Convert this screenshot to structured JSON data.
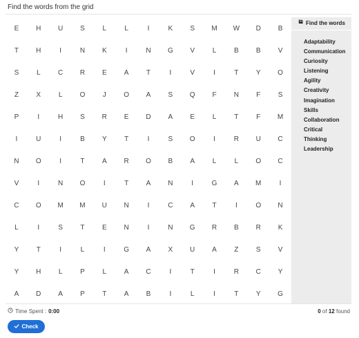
{
  "header": {
    "title": "Find the words from the grid"
  },
  "grid": [
    [
      "E",
      "H",
      "U",
      "S",
      "L",
      "L",
      "I",
      "K",
      "S",
      "M",
      "W",
      "D",
      "B"
    ],
    [
      "T",
      "H",
      "I",
      "N",
      "K",
      "I",
      "N",
      "G",
      "V",
      "L",
      "B",
      "B",
      "V"
    ],
    [
      "S",
      "L",
      "C",
      "R",
      "E",
      "A",
      "T",
      "I",
      "V",
      "I",
      "T",
      "Y",
      "O"
    ],
    [
      "Z",
      "X",
      "L",
      "O",
      "J",
      "O",
      "A",
      "S",
      "Q",
      "F",
      "N",
      "F",
      "S"
    ],
    [
      "P",
      "I",
      "H",
      "S",
      "R",
      "E",
      "D",
      "A",
      "E",
      "L",
      "T",
      "F",
      "M"
    ],
    [
      "I",
      "U",
      "I",
      "B",
      "Y",
      "T",
      "I",
      "S",
      "O",
      "I",
      "R",
      "U",
      "C"
    ],
    [
      "N",
      "O",
      "I",
      "T",
      "A",
      "R",
      "O",
      "B",
      "A",
      "L",
      "L",
      "O",
      "C"
    ],
    [
      "V",
      "I",
      "N",
      "O",
      "I",
      "T",
      "A",
      "N",
      "I",
      "G",
      "A",
      "M",
      "I"
    ],
    [
      "C",
      "O",
      "M",
      "M",
      "U",
      "N",
      "I",
      "C",
      "A",
      "T",
      "I",
      "O",
      "N"
    ],
    [
      "L",
      "I",
      "S",
      "T",
      "E",
      "N",
      "I",
      "N",
      "G",
      "R",
      "B",
      "R",
      "K"
    ],
    [
      "Y",
      "T",
      "I",
      "L",
      "I",
      "G",
      "A",
      "X",
      "U",
      "A",
      "Z",
      "S",
      "V"
    ],
    [
      "Y",
      "H",
      "L",
      "P",
      "L",
      "A",
      "C",
      "I",
      "T",
      "I",
      "R",
      "C",
      "Y"
    ],
    [
      "A",
      "D",
      "A",
      "P",
      "T",
      "A",
      "B",
      "I",
      "L",
      "I",
      "T",
      "Y",
      "G"
    ]
  ],
  "panel": {
    "heading": "Find the words",
    "words": [
      "Adaptability",
      "Communication",
      "Curiosity",
      "Listening",
      "Agility",
      "Creativity",
      "Imagination",
      "Skills",
      "Collaboration",
      "Critical",
      "Thinking",
      "Leadership"
    ]
  },
  "footer": {
    "timer_label": "Time Spent :",
    "timer_value": "0:00",
    "found_count": "0",
    "found_of": "of",
    "found_total": "12",
    "found_suffix": "found",
    "check_label": "Check"
  },
  "colors": {
    "accent": "#1f6fd6",
    "panel_bg": "#ececec"
  },
  "icons": {
    "panel": "book-icon",
    "timer": "clock-icon",
    "check": "checkmark-icon"
  }
}
